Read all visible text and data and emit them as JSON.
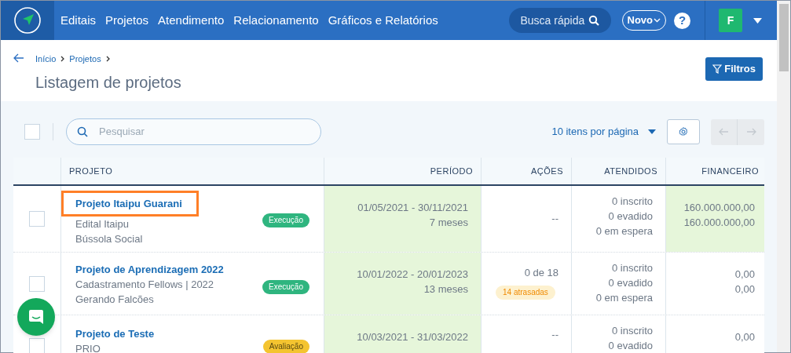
{
  "navbar": {
    "menu": [
      "Editais",
      "Projetos",
      "Atendimento",
      "Relacionamento",
      "Gráficos e Relatórios"
    ],
    "search_placeholder": "Busca rápida",
    "new_button": "Novo",
    "help": "?",
    "avatar": "F"
  },
  "breadcrumb": [
    "Início",
    "Projetos"
  ],
  "page_title": "Listagem de projetos",
  "filter_button": "Filtros",
  "toolbar": {
    "select_all_checked": false,
    "search_placeholder": "Pesquisar",
    "page_size": "10 itens por página"
  },
  "table": {
    "columns": [
      "PROJETO",
      "PERÍODO",
      "AÇÕES",
      "ATENDIDOS",
      "FINANCEIRO"
    ],
    "rows": [
      {
        "checked": false,
        "title": "Projeto Itaipu Guarani",
        "framed": true,
        "lines": [
          "Edital Itaipu",
          "Bússola Social"
        ],
        "status": {
          "label": "Execução",
          "kind": "execution"
        },
        "period": [
          "01/05/2021 - 30/11/2021",
          "7 meses"
        ],
        "period_highlighted": true,
        "actions": "--",
        "overdue": null,
        "attended": [
          "0 inscrito",
          "0 evadido",
          "0 em espera"
        ],
        "financial": [
          "160.000.000,00",
          "160.000.000,00"
        ],
        "financial_highlighted": true
      },
      {
        "checked": false,
        "title": "Projeto de Aprendizagem 2022",
        "framed": false,
        "lines": [
          "Cadastramento Fellows | 2022",
          "Gerando Falcões"
        ],
        "status": {
          "label": "Execução",
          "kind": "execution"
        },
        "period": [
          "10/01/2022 - 20/01/2023",
          "13 meses"
        ],
        "period_highlighted": true,
        "actions": "0 de 18",
        "overdue": "14 atrasadas",
        "attended": [
          "0 inscrito",
          "0 evadido",
          "0 em espera"
        ],
        "financial": [
          "0,00",
          "0,00"
        ],
        "financial_highlighted": false
      },
      {
        "checked": false,
        "title": "Projeto de Teste",
        "framed": false,
        "lines": [
          "PRIO"
        ],
        "status": {
          "label": "Avaliação",
          "kind": "evaluation"
        },
        "period": [
          "10/03/2021 - 31/03/2022"
        ],
        "period_highlighted": true,
        "actions": "--",
        "overdue": null,
        "attended": [
          "0 inscrito",
          "0 evadido"
        ],
        "financial": [
          "0,00"
        ],
        "financial_highlighted": false
      }
    ]
  }
}
